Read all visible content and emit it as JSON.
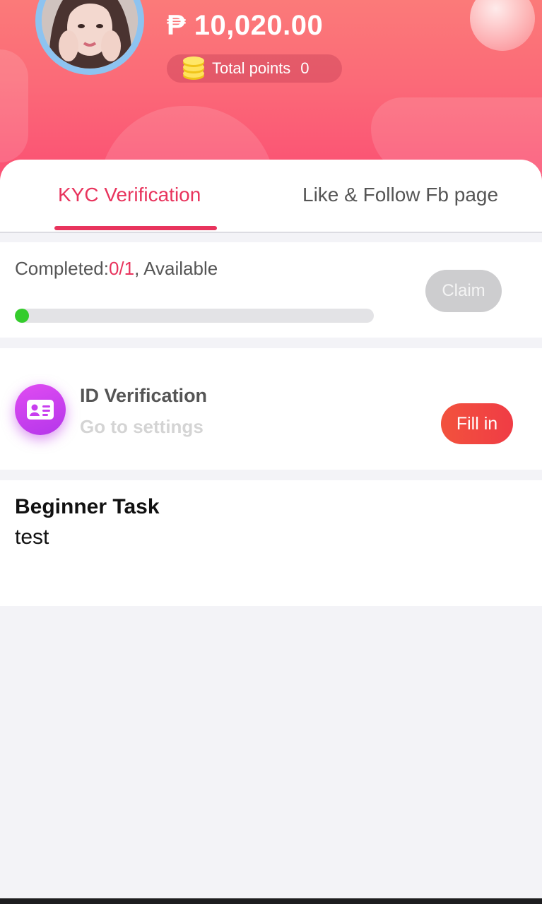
{
  "header": {
    "balance": "₱ 10,020.00",
    "points_label": "Total points",
    "points_value": "0",
    "avatar_icon": "user-photo"
  },
  "tabs": [
    {
      "label": "KYC Verification",
      "active": true
    },
    {
      "label": "Like & Follow Fb page",
      "active": false
    }
  ],
  "progress_card": {
    "completed_prefix": "Completed:",
    "completed_count": "0/1",
    "completed_suffix": ", Available",
    "progress_fraction": 0.04,
    "claim_label": "Claim"
  },
  "task": {
    "icon": "id-card-icon",
    "title": "ID Verification",
    "subtitle": "Go to settings",
    "button_label": "Fill in"
  },
  "beginner": {
    "title": "Beginner Task",
    "description": "test"
  },
  "colors": {
    "accent": "#e8345d",
    "header_top": "#fb7a79",
    "header_bottom": "#fb4f73",
    "progress_fill": "#34cc2c",
    "fill_button": "#f2523d",
    "id_icon": "#c83eef"
  }
}
